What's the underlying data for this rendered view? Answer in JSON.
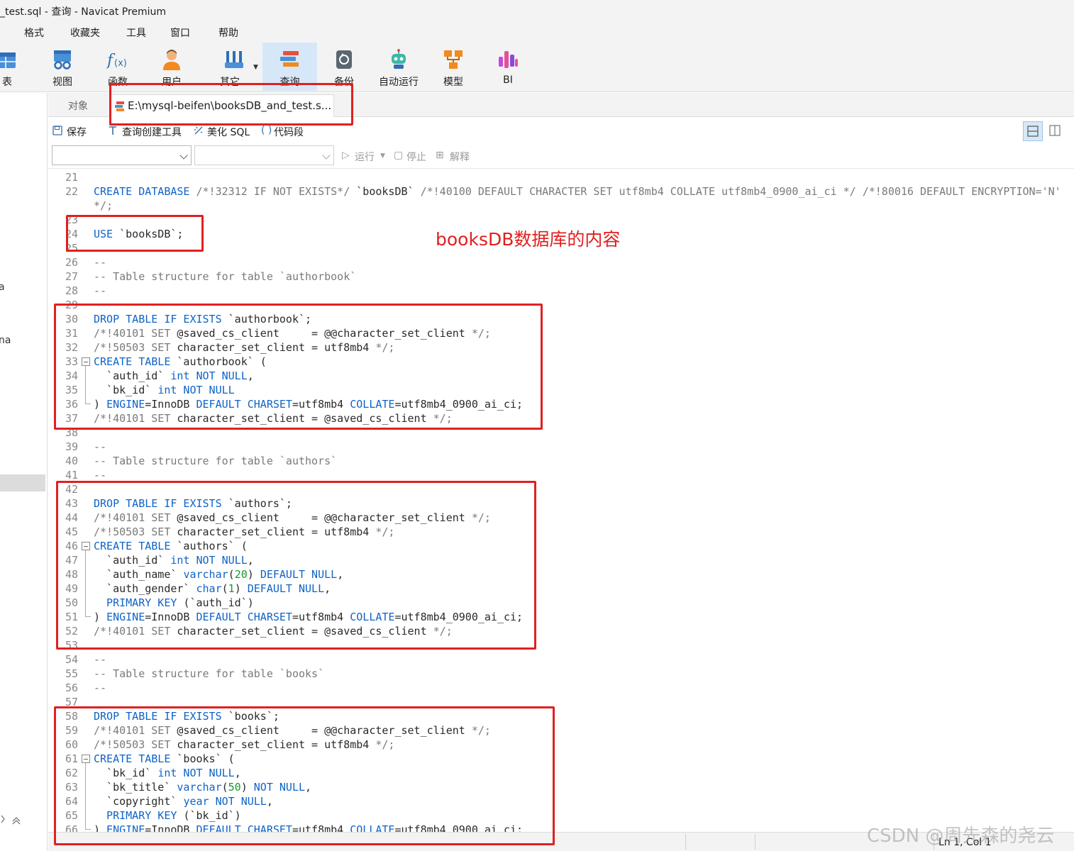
{
  "window": {
    "title": "_test.sql - 查询 - Navicat Premium"
  },
  "menu": [
    "格式",
    "收藏夹",
    "工具",
    "窗口",
    "帮助"
  ],
  "toolbar": [
    {
      "label": "表",
      "icon": "table-icon"
    },
    {
      "label": "视图",
      "icon": "view-icon"
    },
    {
      "label": "函数",
      "icon": "function-icon"
    },
    {
      "label": "用户",
      "icon": "user-icon"
    },
    {
      "label": "其它",
      "icon": "tools-icon"
    },
    {
      "label": "查询",
      "icon": "query-icon"
    },
    {
      "label": "备份",
      "icon": "backup-icon"
    },
    {
      "label": "自动运行",
      "icon": "robot-icon"
    },
    {
      "label": "模型",
      "icon": "model-icon"
    },
    {
      "label": "BI",
      "icon": "bi-icon"
    }
  ],
  "sidebar": {
    "fragments": [
      "a",
      "na"
    ]
  },
  "tabs": {
    "objects": "对象",
    "file": "E:\\mysql-beifen\\booksDB_and_test.s..."
  },
  "editor_toolbar": {
    "save": "保存",
    "query_builder": "查询创建工具",
    "beautify": "美化 SQL",
    "snippet": "代码段"
  },
  "run_toolbar": {
    "run": "运行",
    "stop": "停止",
    "explain": "解释"
  },
  "code_lines": [
    {
      "n": "21",
      "t": []
    },
    {
      "n": "22",
      "t": [
        [
          "k",
          "CREATE DATABASE "
        ],
        [
          "c",
          "/*!32312 IF NOT EXISTS*/ "
        ],
        [
          "x",
          "`booksDB` "
        ],
        [
          "c",
          "/*!40100 DEFAULT CHARACTER SET utf8mb4 COLLATE utf8mb4_0900_ai_ci */ /*!80016 DEFAULT ENCRYPTION='N'"
        ]
      ]
    },
    {
      "n": "",
      "t": [
        [
          "c",
          "*/;"
        ]
      ]
    },
    {
      "n": "23",
      "t": []
    },
    {
      "n": "24",
      "t": [
        [
          "k",
          "USE "
        ],
        [
          "x",
          "`booksDB`;"
        ]
      ]
    },
    {
      "n": "25",
      "t": []
    },
    {
      "n": "26",
      "t": [
        [
          "c",
          "--"
        ]
      ]
    },
    {
      "n": "27",
      "t": [
        [
          "c",
          "-- Table structure for table `authorbook`"
        ]
      ]
    },
    {
      "n": "28",
      "t": [
        [
          "c",
          "--"
        ]
      ]
    },
    {
      "n": "29",
      "t": []
    },
    {
      "n": "30",
      "t": [
        [
          "k",
          "DROP TABLE IF EXISTS "
        ],
        [
          "x",
          "`authorbook`;"
        ]
      ]
    },
    {
      "n": "31",
      "t": [
        [
          "c",
          "/*!40101 SET "
        ],
        [
          "x",
          "@saved_cs_client     = @@character_set_client "
        ],
        [
          "c",
          "*/;"
        ]
      ]
    },
    {
      "n": "32",
      "t": [
        [
          "c",
          "/*!50503 SET "
        ],
        [
          "x",
          "character_set_client = utf8mb4 "
        ],
        [
          "c",
          "*/;"
        ]
      ]
    },
    {
      "n": "33",
      "t": [
        [
          "k",
          "CREATE TABLE "
        ],
        [
          "x",
          "`authorbook` ("
        ]
      ]
    },
    {
      "n": "34",
      "t": [
        [
          "x",
          "  `auth_id` "
        ],
        [
          "k",
          "int NOT NULL"
        ],
        [
          "x",
          ","
        ]
      ]
    },
    {
      "n": "35",
      "t": [
        [
          "x",
          "  `bk_id` "
        ],
        [
          "k",
          "int NOT NULL"
        ]
      ]
    },
    {
      "n": "36",
      "t": [
        [
          "x",
          ") "
        ],
        [
          "k",
          "ENGINE"
        ],
        [
          "x",
          "=InnoDB "
        ],
        [
          "k",
          "DEFAULT CHARSET"
        ],
        [
          "x",
          "=utf8mb4 "
        ],
        [
          "k",
          "COLLATE"
        ],
        [
          "x",
          "=utf8mb4_0900_ai_ci;"
        ]
      ]
    },
    {
      "n": "37",
      "t": [
        [
          "c",
          "/*!40101 SET "
        ],
        [
          "x",
          "character_set_client = @saved_cs_client "
        ],
        [
          "c",
          "*/;"
        ]
      ]
    },
    {
      "n": "38",
      "t": []
    },
    {
      "n": "39",
      "t": [
        [
          "c",
          "--"
        ]
      ]
    },
    {
      "n": "40",
      "t": [
        [
          "c",
          "-- Table structure for table `authors`"
        ]
      ]
    },
    {
      "n": "41",
      "t": [
        [
          "c",
          "--"
        ]
      ]
    },
    {
      "n": "42",
      "t": []
    },
    {
      "n": "43",
      "t": [
        [
          "k",
          "DROP TABLE IF EXISTS "
        ],
        [
          "x",
          "`authors`;"
        ]
      ]
    },
    {
      "n": "44",
      "t": [
        [
          "c",
          "/*!40101 SET "
        ],
        [
          "x",
          "@saved_cs_client     = @@character_set_client "
        ],
        [
          "c",
          "*/;"
        ]
      ]
    },
    {
      "n": "45",
      "t": [
        [
          "c",
          "/*!50503 SET "
        ],
        [
          "x",
          "character_set_client = utf8mb4 "
        ],
        [
          "c",
          "*/;"
        ]
      ]
    },
    {
      "n": "46",
      "t": [
        [
          "k",
          "CREATE TABLE "
        ],
        [
          "x",
          "`authors` ("
        ]
      ]
    },
    {
      "n": "47",
      "t": [
        [
          "x",
          "  `auth_id` "
        ],
        [
          "k",
          "int NOT NULL"
        ],
        [
          "x",
          ","
        ]
      ]
    },
    {
      "n": "48",
      "t": [
        [
          "x",
          "  `auth_name` "
        ],
        [
          "k",
          "varchar"
        ],
        [
          "x",
          "("
        ],
        [
          "n",
          "20"
        ],
        [
          "x",
          ") "
        ],
        [
          "k",
          "DEFAULT NULL"
        ],
        [
          "x",
          ","
        ]
      ]
    },
    {
      "n": "49",
      "t": [
        [
          "x",
          "  `auth_gender` "
        ],
        [
          "k",
          "char"
        ],
        [
          "x",
          "("
        ],
        [
          "n",
          "1"
        ],
        [
          "x",
          ") "
        ],
        [
          "k",
          "DEFAULT NULL"
        ],
        [
          "x",
          ","
        ]
      ]
    },
    {
      "n": "50",
      "t": [
        [
          "k",
          "  PRIMARY KEY "
        ],
        [
          "x",
          "(`auth_id`)"
        ]
      ]
    },
    {
      "n": "51",
      "t": [
        [
          "x",
          ") "
        ],
        [
          "k",
          "ENGINE"
        ],
        [
          "x",
          "=InnoDB "
        ],
        [
          "k",
          "DEFAULT CHARSET"
        ],
        [
          "x",
          "=utf8mb4 "
        ],
        [
          "k",
          "COLLATE"
        ],
        [
          "x",
          "=utf8mb4_0900_ai_ci;"
        ]
      ]
    },
    {
      "n": "52",
      "t": [
        [
          "c",
          "/*!40101 SET "
        ],
        [
          "x",
          "character_set_client = @saved_cs_client "
        ],
        [
          "c",
          "*/;"
        ]
      ]
    },
    {
      "n": "53",
      "t": []
    },
    {
      "n": "54",
      "t": [
        [
          "c",
          "--"
        ]
      ]
    },
    {
      "n": "55",
      "t": [
        [
          "c",
          "-- Table structure for table `books`"
        ]
      ]
    },
    {
      "n": "56",
      "t": [
        [
          "c",
          "--"
        ]
      ]
    },
    {
      "n": "57",
      "t": []
    },
    {
      "n": "58",
      "t": [
        [
          "k",
          "DROP TABLE IF EXISTS "
        ],
        [
          "x",
          "`books`;"
        ]
      ]
    },
    {
      "n": "59",
      "t": [
        [
          "c",
          "/*!40101 SET "
        ],
        [
          "x",
          "@saved_cs_client     = @@character_set_client "
        ],
        [
          "c",
          "*/;"
        ]
      ]
    },
    {
      "n": "60",
      "t": [
        [
          "c",
          "/*!50503 SET "
        ],
        [
          "x",
          "character_set_client = utf8mb4 "
        ],
        [
          "c",
          "*/;"
        ]
      ]
    },
    {
      "n": "61",
      "t": [
        [
          "k",
          "CREATE TABLE "
        ],
        [
          "x",
          "`books` ("
        ]
      ]
    },
    {
      "n": "62",
      "t": [
        [
          "x",
          "  `bk_id` "
        ],
        [
          "k",
          "int NOT NULL"
        ],
        [
          "x",
          ","
        ]
      ]
    },
    {
      "n": "63",
      "t": [
        [
          "x",
          "  `bk_title` "
        ],
        [
          "k",
          "varchar"
        ],
        [
          "x",
          "("
        ],
        [
          "n",
          "50"
        ],
        [
          "x",
          ") "
        ],
        [
          "k",
          "NOT NULL"
        ],
        [
          "x",
          ","
        ]
      ]
    },
    {
      "n": "64",
      "t": [
        [
          "x",
          "  `copyright` "
        ],
        [
          "k",
          "year NOT NULL"
        ],
        [
          "x",
          ","
        ]
      ]
    },
    {
      "n": "65",
      "t": [
        [
          "k",
          "  PRIMARY KEY "
        ],
        [
          "x",
          "(`bk_id`)"
        ]
      ]
    },
    {
      "n": "66",
      "t": [
        [
          "x",
          ") "
        ],
        [
          "k",
          "ENGINE"
        ],
        [
          "x",
          "=InnoDB "
        ],
        [
          "k",
          "DEFAULT CHARSET"
        ],
        [
          "x",
          "=utf8mb4 "
        ],
        [
          "k",
          "COLLATE"
        ],
        [
          "x",
          "=utf8mb4_0900_ai_ci;"
        ]
      ]
    }
  ],
  "status": {
    "position": "Ln 1, Col 1"
  },
  "annotation": {
    "text": "booksDB数据库的内容"
  },
  "watermark": "CSDN @周先森的尧云",
  "colors": {
    "keyword": "#0f63c7",
    "comment": "#7a7a7a",
    "number": "#139a2a",
    "annotation": "#e02020",
    "active_tool": "#d6e8f8"
  }
}
